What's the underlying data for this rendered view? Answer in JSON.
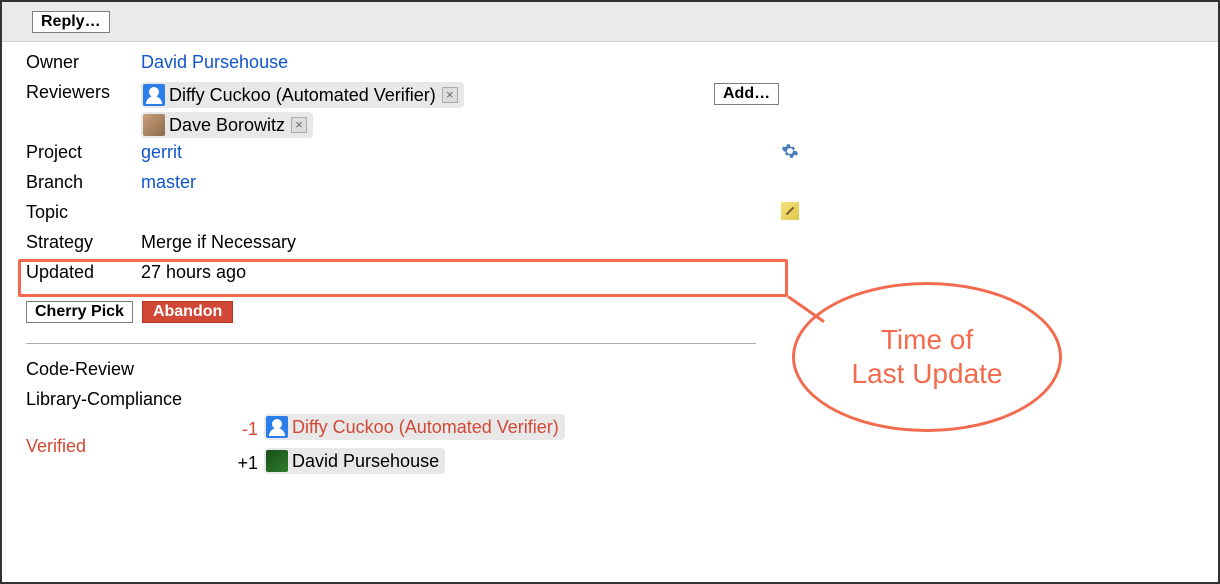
{
  "toolbar": {
    "reply_label": "Reply…"
  },
  "fields": {
    "owner_label": "Owner",
    "owner_value": "David Pursehouse",
    "reviewers_label": "Reviewers",
    "add_label": "Add…",
    "project_label": "Project",
    "project_value": "gerrit",
    "branch_label": "Branch",
    "branch_value": "master",
    "topic_label": "Topic",
    "strategy_label": "Strategy",
    "strategy_value": "Merge if Necessary",
    "updated_label": "Updated",
    "updated_value": "27 hours ago"
  },
  "reviewers": [
    {
      "name": "Diffy Cuckoo (Automated Verifier)"
    },
    {
      "name": "Dave Borowitz"
    }
  ],
  "actions": {
    "cherry_pick": "Cherry Pick",
    "abandon": "Abandon"
  },
  "labels": {
    "code_review": "Code-Review",
    "library_compliance": "Library-Compliance",
    "verified": "Verified"
  },
  "verified_votes": [
    {
      "score": "-1",
      "name": "Diffy Cuckoo (Automated Verifier)",
      "red": true
    },
    {
      "score": "+1",
      "name": "David Pursehouse",
      "red": false
    }
  ],
  "annotation": {
    "text": "Time of\nLast Update"
  }
}
